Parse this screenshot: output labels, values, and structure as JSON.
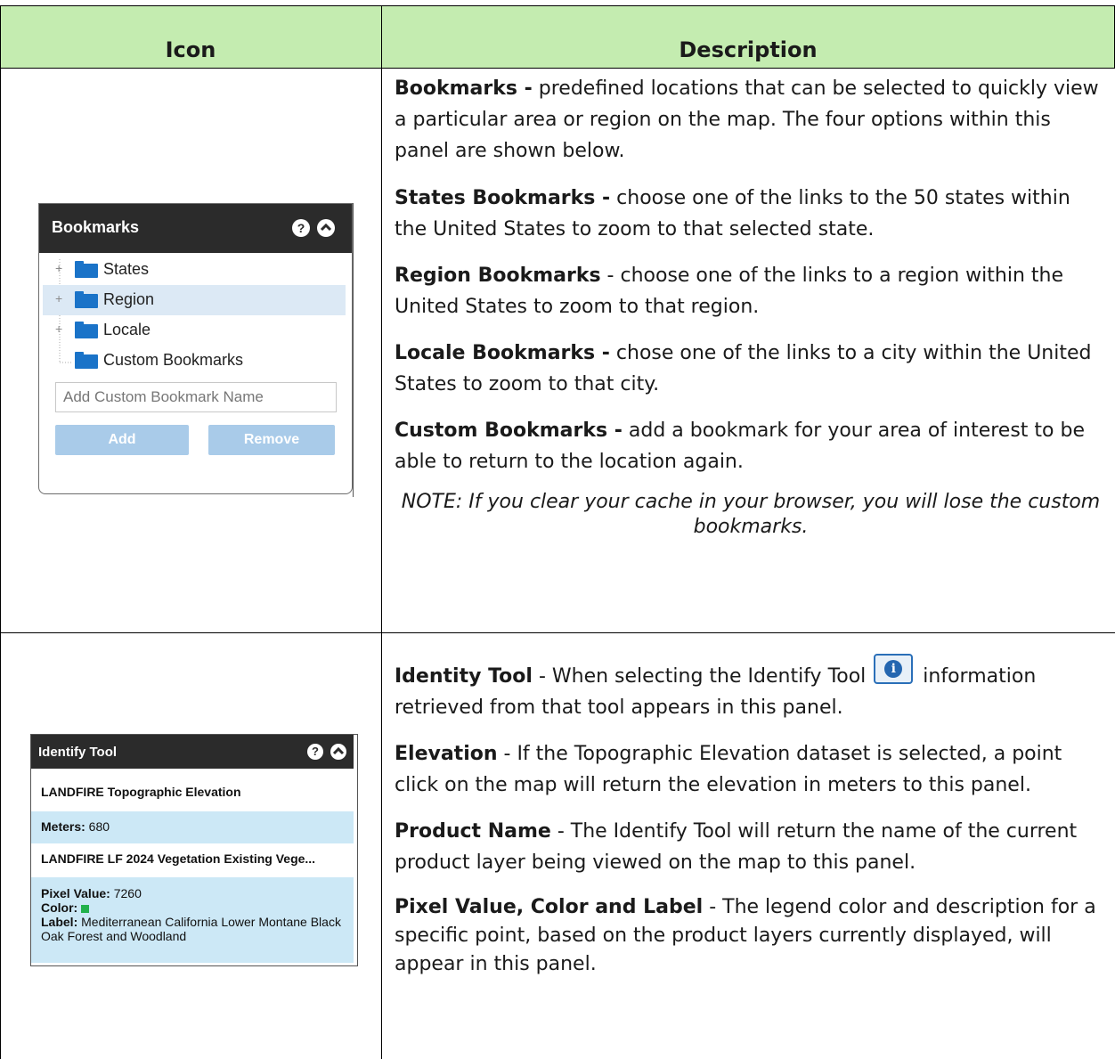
{
  "header": {
    "icon_col": "Icon",
    "description_col": "Description"
  },
  "row1": {
    "panel": {
      "title": "Bookmarks",
      "help_icon": "question-circle-icon",
      "collapse_icon": "chevron-up-circle-icon",
      "tree": [
        {
          "label": "States",
          "expandable": true,
          "selected": false
        },
        {
          "label": "Region",
          "expandable": true,
          "selected": true
        },
        {
          "label": "Locale",
          "expandable": true,
          "selected": false
        },
        {
          "label": "Custom Bookmarks",
          "expandable": false,
          "selected": false
        }
      ],
      "input_placeholder": "Add Custom Bookmark Name",
      "add_button": "Add",
      "remove_button": "Remove"
    },
    "desc": {
      "p1_bold": "Bookmarks -",
      "p1_text": " predefined locations that can be selected to quickly view a particular area or region on the map. The four options within this panel are shown below.",
      "p2_bold": "States Bookmarks -",
      "p2_text": " choose one of the links to the 50 states within the United States to zoom to that selected state.",
      "p3_bold": "Region Bookmarks",
      "p3_text": " - choose one of the links to a region within the United States to zoom to that region.",
      "p4_bold": "Locale Bookmarks -",
      "p4_text": " chose one of the links to a city within the United States to zoom to that city.",
      "p5_bold": "Custom Bookmarks -",
      "p5_text": " add a bookmark for your area of interest to be able to return to the location again.",
      "note": "NOTE: If you clear your cache in your browser, you will lose the custom bookmarks."
    }
  },
  "row2": {
    "panel": {
      "title": "Identify Tool",
      "help_icon": "question-circle-icon",
      "collapse_icon": "chevron-up-circle-icon",
      "dataset1": "LANDFIRE Topographic Elevation",
      "meters_label": "Meters:",
      "meters_value": " 680",
      "dataset2": "LANDFIRE LF 2024 Vegetation Existing Vege...",
      "pixel_label": "Pixel Value:",
      "pixel_value": " 7260",
      "color_label": "Color:",
      "swatch_color": "#22b14c",
      "label_label": "Label:",
      "label_value": " Mediterranean California Lower Montane Black Oak Forest and Woodland"
    },
    "desc": {
      "p1_bold": "Identity Tool",
      "p1_text_a": " - When selecting the Identify Tool ",
      "p1_text_b": " information retrieved from that tool appears in this panel.",
      "info_icon": "info-circle-icon",
      "p2_bold": "Elevation",
      "p2_text": " - If the Topographic Elevation dataset is selected, a point click on the map will return the elevation in meters to this panel.",
      "p3_bold": "Product Name",
      "p3_text": " - The Identify Tool will return the name of the current product layer being viewed on the map to this panel.",
      "p4_bold": "Pixel Value, Color and Label",
      "p4_text": " - The legend color and description for a specific point, based on the product layers currently displayed, will appear in this panel."
    }
  }
}
